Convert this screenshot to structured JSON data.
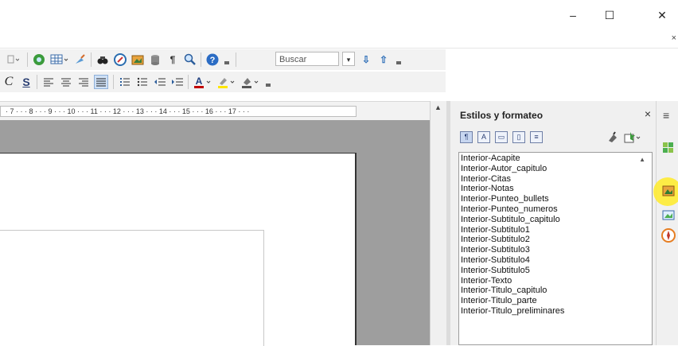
{
  "window": {
    "minimize_glyph": "–",
    "maximize_glyph": "☐",
    "close_glyph": "✕",
    "menu_close_glyph": "×"
  },
  "toolbar1": {
    "search_placeholder": "Buscar",
    "icons": [
      "paste-dropdown-icon",
      "navigator-icon",
      "table-icon",
      "draw-functions-icon",
      "find-replace-icon",
      "basic-shapes-icon",
      "insert-image-icon",
      "database-icon",
      "formatting-marks-icon",
      "zoom-icon",
      "help-icon",
      "search-down-icon",
      "search-up-icon"
    ]
  },
  "toolbar2": {
    "italic_label": "C",
    "underline_label": "S",
    "icons": [
      "align-left-icon",
      "align-center-icon",
      "align-right-icon",
      "justify-icon",
      "numbering-icon",
      "bullets-icon",
      "decrease-indent-icon",
      "increase-indent-icon",
      "font-color-icon",
      "highlight-icon",
      "background-color-icon"
    ]
  },
  "ruler": {
    "text": "· 7 · · · 8 · · · 9 · · · 10 · · · 11 · · · 12 · · · 13 · · · 14 · · · 15 · · · 16 · · · 17 · · ·"
  },
  "panel": {
    "title": "Estilos y formateo",
    "close_glyph": "×",
    "styles": [
      "Interior-Acapite",
      "Interior-Autor_capitulo",
      "Interior-Citas",
      "Interior-Notas",
      "Interior-Punteo_bullets",
      "Interior-Punteo_numeros",
      "Interior-Subtitulo_capitulo",
      "Interior-Subtitulo1",
      "Interior-Subtitulo2",
      "Interior-Subtitulo3",
      "Interior-Subtitulo4",
      "Interior-Subtitulo5",
      "Interior-Texto",
      "Interior-Titulo_capitulo",
      "Interior-Titulo_parte",
      "Interior-Titulo_preliminares"
    ]
  },
  "sidebar_deck": {
    "menu_glyph": "≡",
    "icons": [
      "properties-icon",
      "styles-icon",
      "gallery-icon",
      "navigator-icon"
    ]
  },
  "colors": {
    "accent_highlight": "#ffeb28",
    "doc_background": "#9e9e9e",
    "panel_background": "#f0f0f0"
  }
}
